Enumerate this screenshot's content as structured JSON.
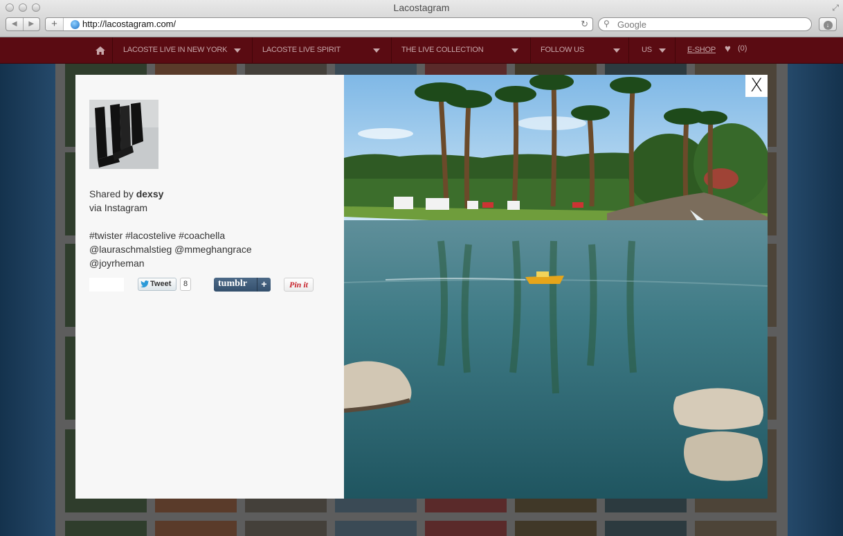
{
  "browser": {
    "window_title": "Lacostagram",
    "url": "http://lacostagram.com/",
    "search_placeholder": "Google"
  },
  "nav": {
    "items": [
      {
        "label": "LACOSTE LIVE IN NEW YORK"
      },
      {
        "label": "LACOSTE LIVE SPIRIT"
      },
      {
        "label": "THE LIVE COLLECTION"
      },
      {
        "label": "FOLLOW US"
      },
      {
        "label": "US"
      }
    ],
    "eshop_label": "E-SHOP",
    "likes_count": "(0)"
  },
  "lightbox": {
    "shared_prefix": "Shared by ",
    "username": "dexsy",
    "via": "via Instagram",
    "caption_lines": [
      "#twister #lacostelive #coachella",
      "@lauraschmalstieg @mmeghangrace",
      "@joyrheman"
    ],
    "tweet_label": "Tweet",
    "tweet_count": "8",
    "tumblr_label": "tumblr",
    "tumblr_plus": "+",
    "pin_label": "Pin it",
    "close_label": "X"
  },
  "colors": {
    "nav_bg": "#5a0b12",
    "panel_bg": "#f7f7f7"
  }
}
